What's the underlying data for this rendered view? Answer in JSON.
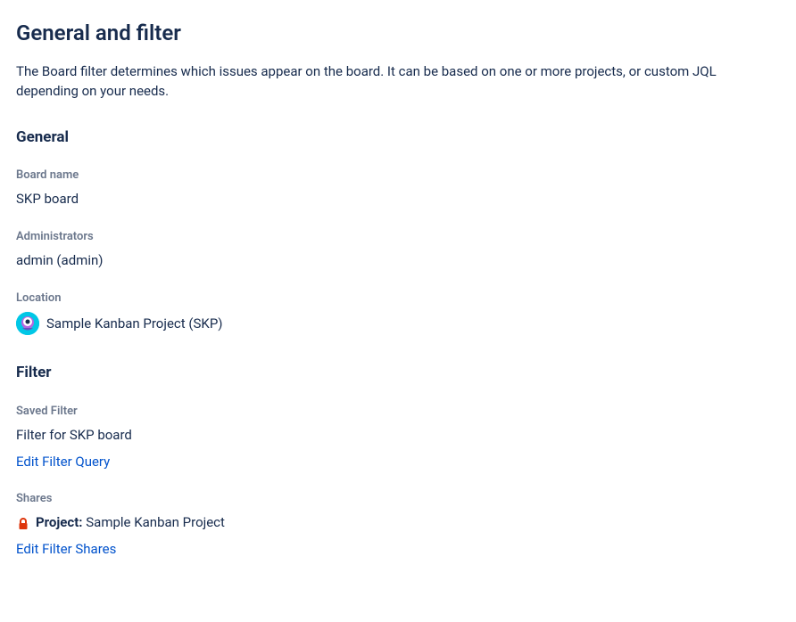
{
  "page": {
    "title": "General and filter",
    "description": "The Board filter determines which issues appear on the board. It can be based on one or more projects, or custom JQL depending on your needs."
  },
  "general": {
    "heading": "General",
    "board_name": {
      "label": "Board name",
      "value": "SKP board"
    },
    "administrators": {
      "label": "Administrators",
      "value": "admin (admin)"
    },
    "location": {
      "label": "Location",
      "value": "Sample Kanban Project (SKP)",
      "avatar_color": "#00C7E6"
    }
  },
  "filter": {
    "heading": "Filter",
    "saved_filter": {
      "label": "Saved Filter",
      "value": "Filter for SKP board",
      "edit_link": "Edit Filter Query"
    },
    "shares": {
      "label": "Shares",
      "project_prefix": "Project:",
      "project_name": "Sample Kanban Project",
      "lock_icon_color": "#DE350B",
      "edit_link": "Edit Filter Shares"
    }
  }
}
